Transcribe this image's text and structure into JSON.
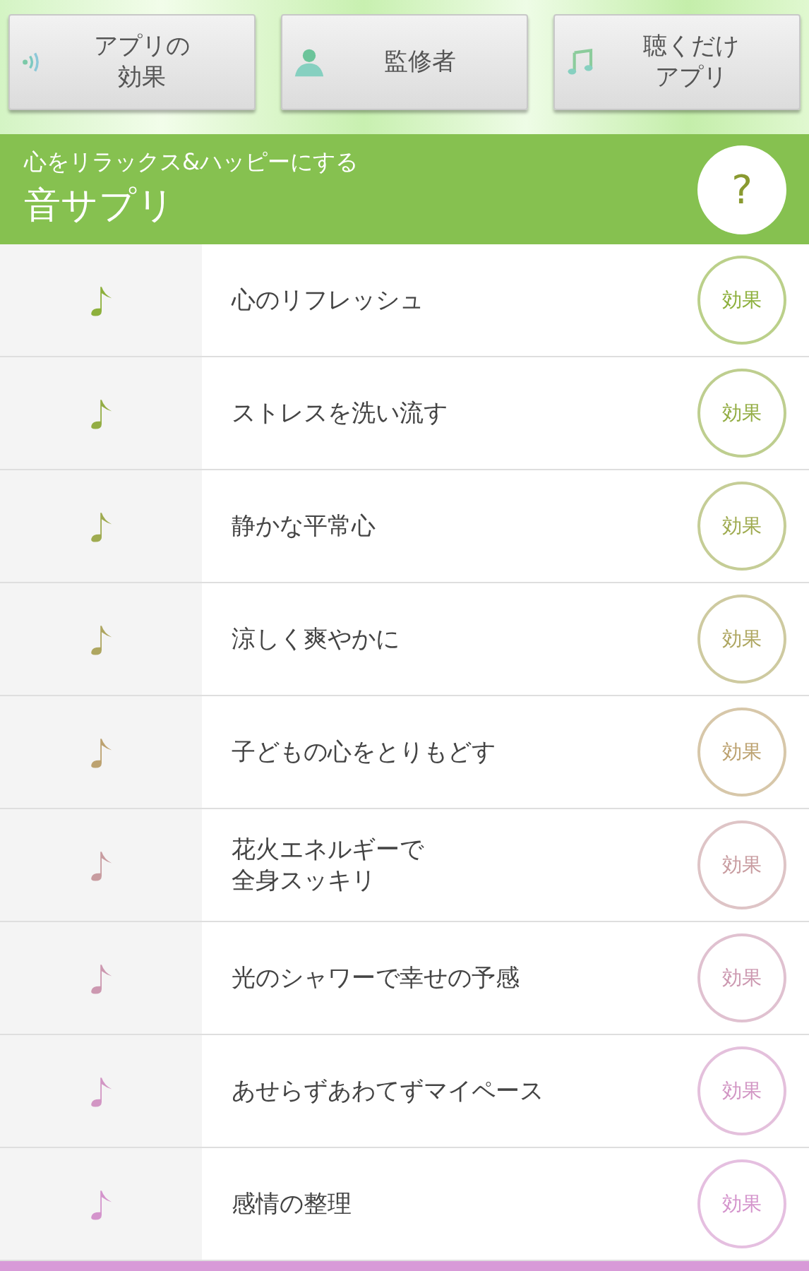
{
  "nav_buttons": [
    {
      "label": "アプリの効果",
      "kind": "sound"
    },
    {
      "label": "監修者",
      "kind": "person"
    },
    {
      "label": "聴くだけアプリ",
      "kind": "music"
    }
  ],
  "header": {
    "subtitle": "心をリラックス&ハッピーにする",
    "title": "音サプリ",
    "help_button": "?"
  },
  "tracks": [
    {
      "title": "心のリフレッシュ",
      "button": "効果",
      "color": "#8db03c"
    },
    {
      "title": "ストレスを洗い流す",
      "button": "効果",
      "color": "#93ad44"
    },
    {
      "title": "静かな平常心",
      "button": "効果",
      "color": "#9fab50"
    },
    {
      "title": "涼しく爽やかに",
      "button": "効果",
      "color": "#aea660"
    },
    {
      "title": "子どもの心をとりもどす",
      "button": "効果",
      "color": "#bca270"
    },
    {
      "title": "花火エネルギーで",
      "title_line_2": "全身スッキリ",
      "button": "効果",
      "color": "#c89ca0"
    },
    {
      "title": "光のシャワーで幸せの予感",
      "button": "効果",
      "color": "#cc98b0"
    },
    {
      "title": "あせらずあわてずマイペース",
      "button": "効果",
      "color": "#d296c4"
    },
    {
      "title": "感情の整理",
      "button": "効果",
      "color": "#d494cc"
    }
  ]
}
